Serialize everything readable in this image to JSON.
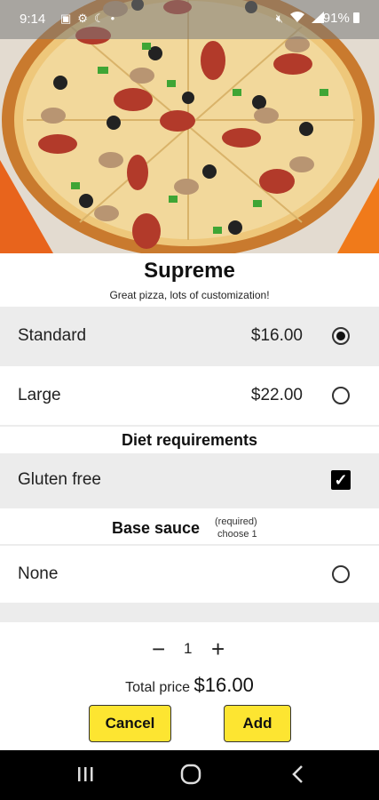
{
  "status_bar": {
    "time": "9:14",
    "battery": "91%",
    "icons": [
      "image-icon",
      "gear-icon",
      "moon-icon",
      "dot-icon",
      "mute-icon",
      "wifi-icon",
      "signal-icon",
      "battery-icon"
    ]
  },
  "product": {
    "name": "Supreme",
    "description": "Great pizza, lots of customization!"
  },
  "sizes": [
    {
      "label": "Standard",
      "price": "$16.00",
      "selected": true
    },
    {
      "label": "Large",
      "price": "$22.00",
      "selected": false
    }
  ],
  "diet": {
    "header": "Diet requirements",
    "options": [
      {
        "label": "Gluten free",
        "checked": true
      }
    ]
  },
  "base_sauce": {
    "header": "Base sauce",
    "required_note": "(required)",
    "choose_note": "choose 1",
    "options": [
      {
        "label": "None",
        "selected": false
      }
    ]
  },
  "order": {
    "quantity": "1",
    "minus": "−",
    "plus": "+",
    "total_label": "Total price",
    "total_value": "$16.00",
    "cancel_label": "Cancel",
    "add_label": "Add"
  },
  "colors": {
    "button_yellow": "#fde531",
    "row_grey": "#ececec"
  }
}
